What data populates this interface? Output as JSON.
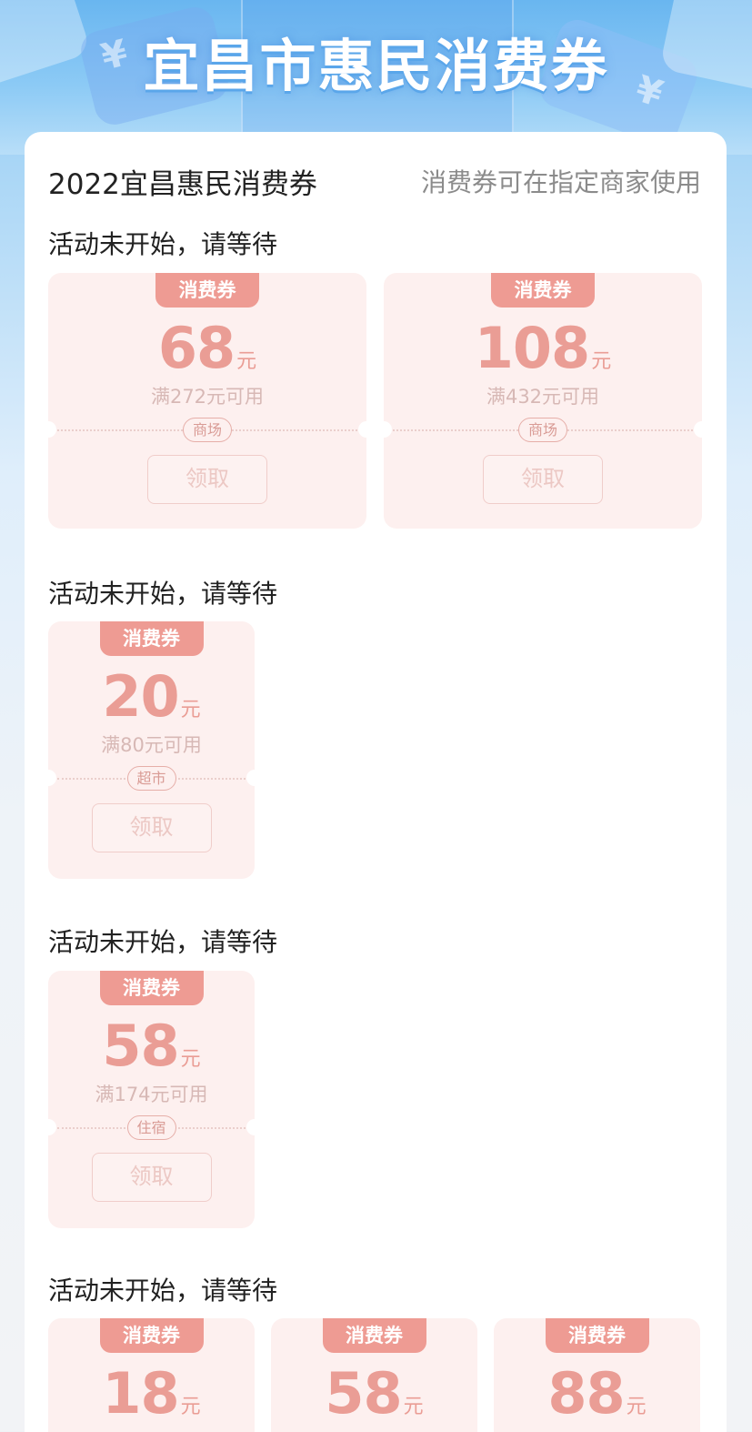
{
  "banner": {
    "title": "宜昌市惠民消费券",
    "yen_symbol": "¥"
  },
  "header": {
    "title": "2022宜昌惠民消费券",
    "note": "消费券可在指定商家使用"
  },
  "colors": {
    "accent": "#ee9b93",
    "amount": "#ea9d95",
    "coupon_bg": "#fdf0ef",
    "banner_blue": "#69b6f0"
  },
  "sections": [
    {
      "status": "活动未开始，请等待",
      "coupons": [
        {
          "tag": "消费券",
          "amount": "68",
          "unit": "元",
          "condition": "满272元可用",
          "category": "商场",
          "button": "领取"
        },
        {
          "tag": "消费券",
          "amount": "108",
          "unit": "元",
          "condition": "满432元可用",
          "category": "商场",
          "button": "领取"
        }
      ]
    },
    {
      "status": "活动未开始，请等待",
      "coupons": [
        {
          "tag": "消费券",
          "amount": "20",
          "unit": "元",
          "condition": "满80元可用",
          "category": "超市",
          "button": "领取"
        }
      ]
    },
    {
      "status": "活动未开始，请等待",
      "coupons": [
        {
          "tag": "消费券",
          "amount": "58",
          "unit": "元",
          "condition": "满174元可用",
          "category": "住宿",
          "button": "领取"
        }
      ]
    },
    {
      "status": "活动未开始，请等待",
      "coupons": [
        {
          "tag": "消费券",
          "amount": "18",
          "unit": "元"
        },
        {
          "tag": "消费券",
          "amount": "58",
          "unit": "元"
        },
        {
          "tag": "消费券",
          "amount": "88",
          "unit": "元"
        }
      ]
    }
  ]
}
